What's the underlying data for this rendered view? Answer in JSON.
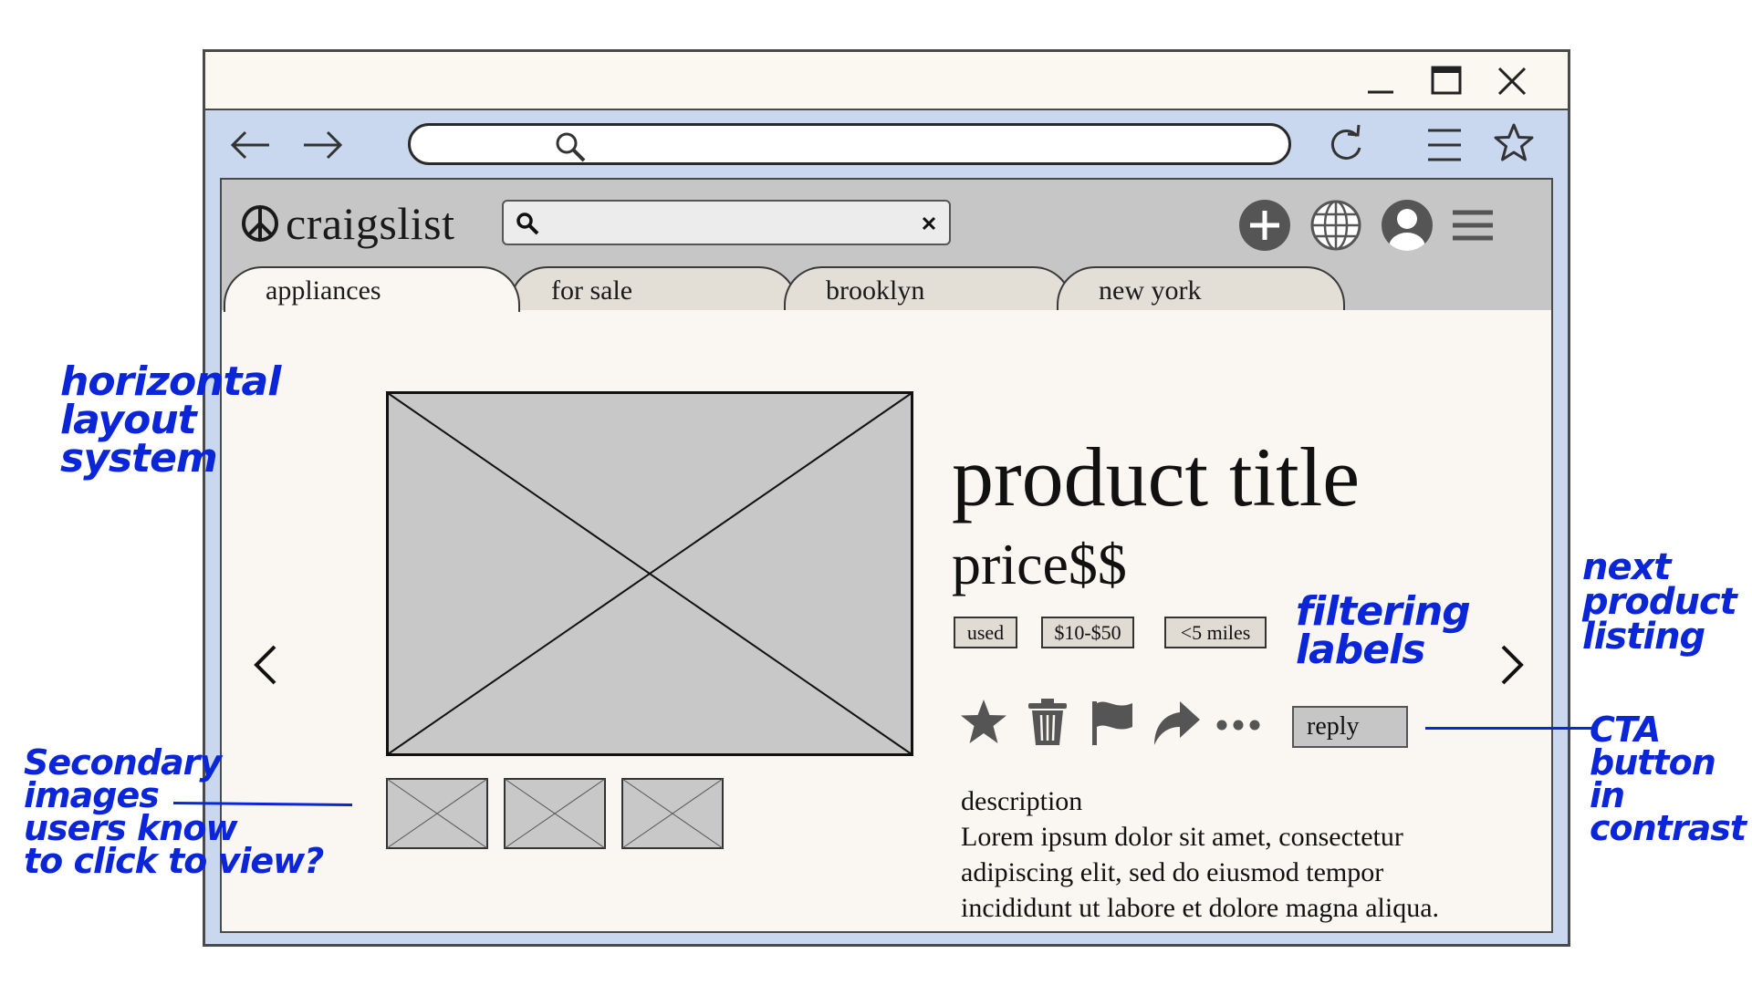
{
  "site": {
    "logo": "craigslist",
    "tabs": [
      "appliances",
      "for sale",
      "brooklyn",
      "new york"
    ]
  },
  "product": {
    "title": "product title",
    "price": "price$$",
    "filter_labels": [
      "used",
      "$10-$50",
      "<5 miles"
    ],
    "reply_label": "reply",
    "description_heading": "description",
    "description_text": "Lorem ipsum dolor sit amet, consectetur\nadipiscing elit, sed do eiusmod tempor\nincididunt ut labore et dolore magna aliqua."
  },
  "annotations": {
    "layout": "horizontal\nlayout\nsystem",
    "secondary": "Secondary\nimages\nusers know\nto click to view?",
    "filters": "filtering\nlabels",
    "next": "next\nproduct\nlisting",
    "cta": "CTA\nbutton in\ncontrast"
  },
  "colors": {
    "browser_chrome": "#c9d8ee",
    "site_header": "#c6c6c6",
    "page_bg": "#faf6f1",
    "annotation_ink": "#0b25d8"
  }
}
